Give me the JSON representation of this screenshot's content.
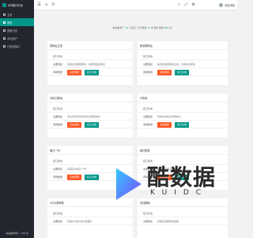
{
  "app": {
    "title": "API接口平台"
  },
  "sidebar": {
    "items": [
      {
        "label": "主页",
        "icon": "home-icon"
      },
      {
        "label": "首页",
        "icon": "list-icon",
        "active": true
      },
      {
        "label": "更新日志",
        "icon": "log-icon"
      },
      {
        "label": "本站用户",
        "icon": "user-icon"
      },
      {
        "label": "已收录接口",
        "icon": "api-icon"
      }
    ],
    "footer": "本站被调用了 798 次"
  },
  "topbar": {
    "icons": [
      "menu-icon",
      "home-icon",
      "refresh-icon",
      "search-icon",
      "fullscreen-icon",
      "settings-icon"
    ],
    "user_label": "欢迎来到"
  },
  "stats": {
    "prefix": "本站收录了",
    "api_count": "10",
    "mid1": "个接口 今日调用",
    "today_count": "12",
    "mid2": "次 累计调用",
    "total_count": "660",
    "suffix": "次"
  },
  "labels": {
    "status_key": "接口状态",
    "desc_key": "主要用途",
    "ops_key": "调用数量",
    "call_btn": "点击调用",
    "doc_btn": "接口文档"
  },
  "cards": [
    {
      "title": "短网址生成",
      "desc": "获取生成的短网址，或者短链接网址"
    },
    {
      "title": "新浪短网址",
      "desc": "提供新浪短网址生成，为你在线获取"
    },
    {
      "title": "手机归属地",
      "desc": "通过手机号查询手机归属地信息"
    },
    {
      "title": "IP查询",
      "desc": "查询IP地址的详细信息"
    },
    {
      "title": "每日一句",
      "desc": "获取英文每日一句"
    },
    {
      "title": "每日壁纸",
      "desc": "获取必应每日壁纸"
    },
    {
      "title": "QQ头像获取",
      "desc": "获取QQ用户的头像图片"
    },
    {
      "title": "在线翻译",
      "desc": "获取百度翻译的结果"
    }
  ],
  "watermark": {
    "text": "酷数据",
    "sub": "KUIDC"
  },
  "colors": {
    "accent": "#009688",
    "orange": "#ff5722",
    "sidebar": "#23262e"
  }
}
